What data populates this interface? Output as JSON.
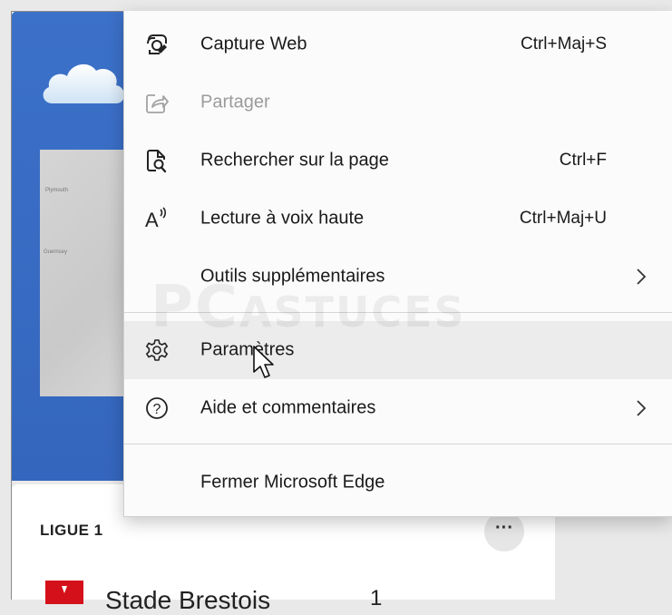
{
  "menu": {
    "items": [
      {
        "label": "Capture Web",
        "shortcut": "Ctrl+Maj+S",
        "icon": "web-capture-icon",
        "disabled": false
      },
      {
        "label": "Partager",
        "shortcut": "",
        "icon": "share-icon",
        "disabled": true
      },
      {
        "label": "Rechercher sur la page",
        "shortcut": "Ctrl+F",
        "icon": "find-on-page-icon",
        "disabled": false
      },
      {
        "label": "Lecture à voix haute",
        "shortcut": "Ctrl+Maj+U",
        "icon": "read-aloud-icon",
        "disabled": false
      },
      {
        "label": "Outils supplémentaires",
        "submenu": true
      },
      {
        "label": "Paramètres",
        "icon": "gear-icon",
        "hovered": true
      },
      {
        "label": "Aide et commentaires",
        "icon": "help-icon",
        "submenu": true
      },
      {
        "label": "Fermer Microsoft Edge"
      }
    ],
    "read_aloud_icon_glyph": "A",
    "help_icon_glyph": "?"
  },
  "background": {
    "sports_title": "LIGUE 1",
    "more_button": "···",
    "team_name": "Stade Brestois",
    "team_score": "1",
    "map_places": [
      "Plymouth",
      "Guernsey"
    ]
  },
  "watermark": {
    "part1": "PC",
    "part2": "ASTUCES"
  },
  "colors": {
    "weather_bg": "#3466bd",
    "menu_bg": "#fbfbfb",
    "hover_bg": "#ececec",
    "disabled_text": "#9b9b9b"
  }
}
